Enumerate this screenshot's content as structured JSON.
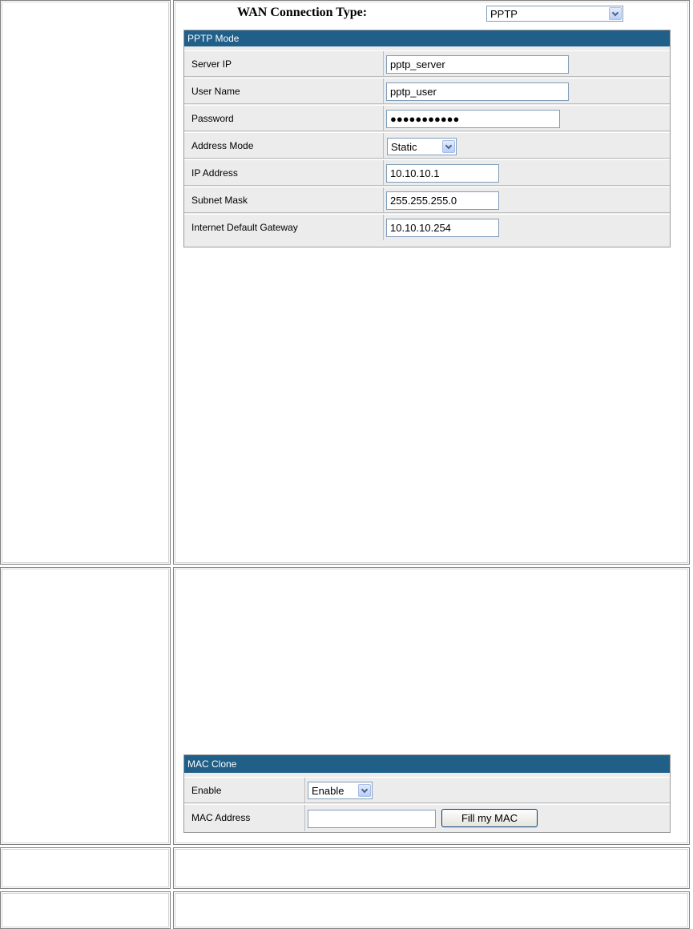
{
  "wan": {
    "label": "WAN Connection Type:",
    "selected": "PPTP"
  },
  "pptp": {
    "header": "PPTP Mode",
    "fields": [
      {
        "label": "Server IP",
        "value": "pptp_server"
      },
      {
        "label": "User Name",
        "value": "pptp_user"
      },
      {
        "label": "Password",
        "value": "●●●●●●●●●●●"
      },
      {
        "label": "Address Mode",
        "value": "Static"
      },
      {
        "label": "IP Address",
        "value": "10.10.10.1"
      },
      {
        "label": "Subnet Mask",
        "value": "255.255.255.0"
      },
      {
        "label": "Internet Default Gateway",
        "value": "10.10.10.254"
      }
    ]
  },
  "mac": {
    "header": "MAC Clone",
    "enable_label": "Enable",
    "enable_value": "Enable",
    "address_label": "MAC Address",
    "address_value": "",
    "fill_button": "Fill my MAC"
  },
  "icons": {
    "dropdown": "chevron-down-icon"
  },
  "colors": {
    "section_header_bg": "#1f5f88",
    "row_bg": "#ececec",
    "input_border": "#7f9db9"
  }
}
